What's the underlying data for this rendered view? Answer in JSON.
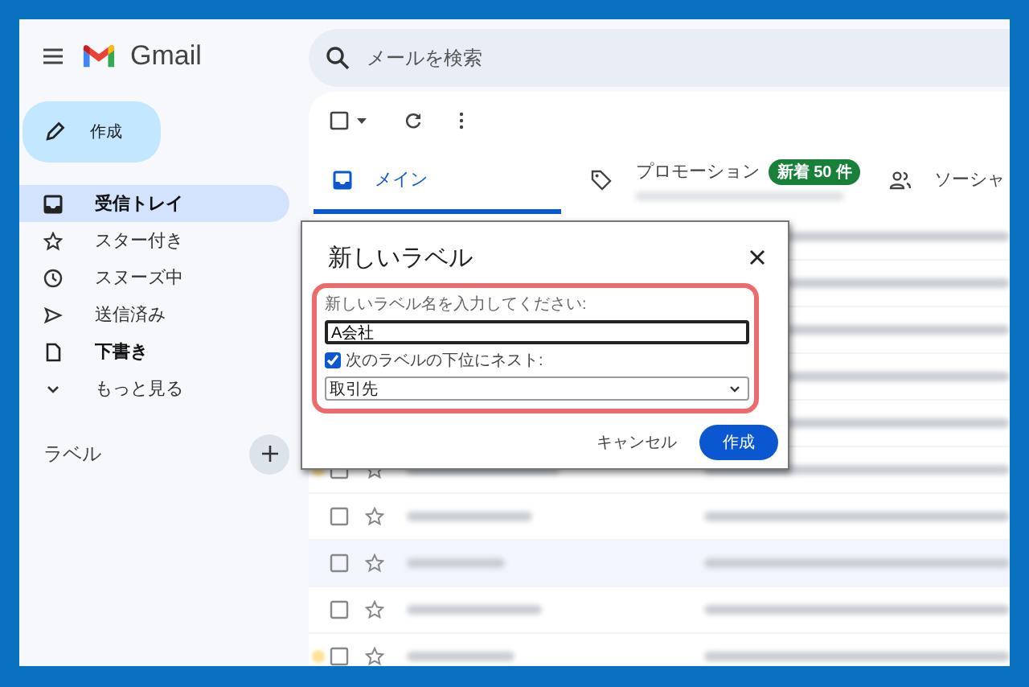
{
  "app": {
    "name": "Gmail"
  },
  "search": {
    "placeholder": "メールを検索"
  },
  "compose": {
    "label": "作成"
  },
  "nav": [
    {
      "label": "受信トレイ",
      "selected": true,
      "unread": true
    },
    {
      "label": "スター付き",
      "selected": false,
      "unread": false
    },
    {
      "label": "スヌーズ中",
      "selected": false,
      "unread": false
    },
    {
      "label": "送信済み",
      "selected": false,
      "unread": false
    },
    {
      "label": "下書き",
      "selected": false,
      "unread": true
    },
    {
      "label": "もっと見る",
      "selected": false,
      "unread": false
    }
  ],
  "labels_section": {
    "title": "ラベル"
  },
  "tabs": [
    {
      "label": "メイン",
      "selected": true
    },
    {
      "label": "プロモーション",
      "selected": false,
      "badge": "新着 50 件"
    },
    {
      "label": "ソーシャ",
      "selected": false
    }
  ],
  "email_rows": [
    {
      "highlighted": false
    },
    {
      "highlighted": false
    },
    {
      "highlighted": false
    },
    {
      "highlighted": false
    },
    {
      "highlighted": false
    },
    {
      "important": true,
      "highlighted": false
    },
    {
      "important": false,
      "highlighted": false
    },
    {
      "important": false,
      "highlighted": true
    },
    {
      "important": false,
      "highlighted": false
    },
    {
      "important": true,
      "highlighted": false
    }
  ],
  "dialog": {
    "title": "新しいラベル",
    "name_prompt": "新しいラベル名を入力してください:",
    "name_value": "A会社",
    "nest_checked": true,
    "nest_label": "次のラベルの下位にネスト:",
    "parent_value": "取引先",
    "cancel": "キャンセル",
    "create": "作成"
  }
}
